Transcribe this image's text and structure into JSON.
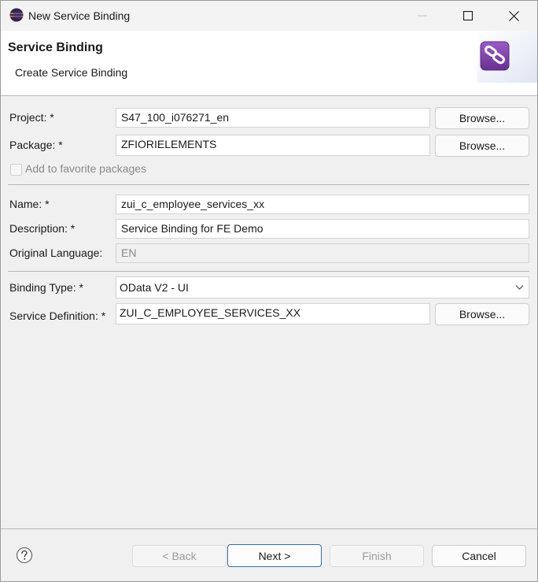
{
  "window": {
    "title": "New Service Binding",
    "icon": "eclipse-icon"
  },
  "banner": {
    "title": "Service Binding",
    "subtitle": "Create Service Binding",
    "art_icon": "service-binding-link-icon",
    "accent_color": "#7b3fa0"
  },
  "form": {
    "project": {
      "label": "Project: *",
      "value": "S47_100_i076271_en",
      "browse_label": "Browse..."
    },
    "package": {
      "label": "Package: *",
      "value": "ZFIORIELEMENTS",
      "browse_label": "Browse..."
    },
    "favorites": {
      "label": "Add to favorite packages",
      "checked": false,
      "enabled": false
    },
    "name": {
      "label": "Name: *",
      "value": "zui_c_employee_services_xx"
    },
    "description": {
      "label": "Description: *",
      "value": "Service Binding for FE Demo"
    },
    "original_language": {
      "label": "Original Language:",
      "value": "EN"
    },
    "binding_type": {
      "label": "Binding Type: *",
      "value": "OData V2 - UI"
    },
    "service_definition": {
      "label": "Service Definition: *",
      "value": "ZUI_C_EMPLOYEE_SERVICES_XX",
      "browse_label": "Browse..."
    }
  },
  "footer": {
    "help_icon": "help-question-icon",
    "back_label": "< Back",
    "next_label": "Next >",
    "finish_label": "Finish",
    "cancel_label": "Cancel"
  }
}
